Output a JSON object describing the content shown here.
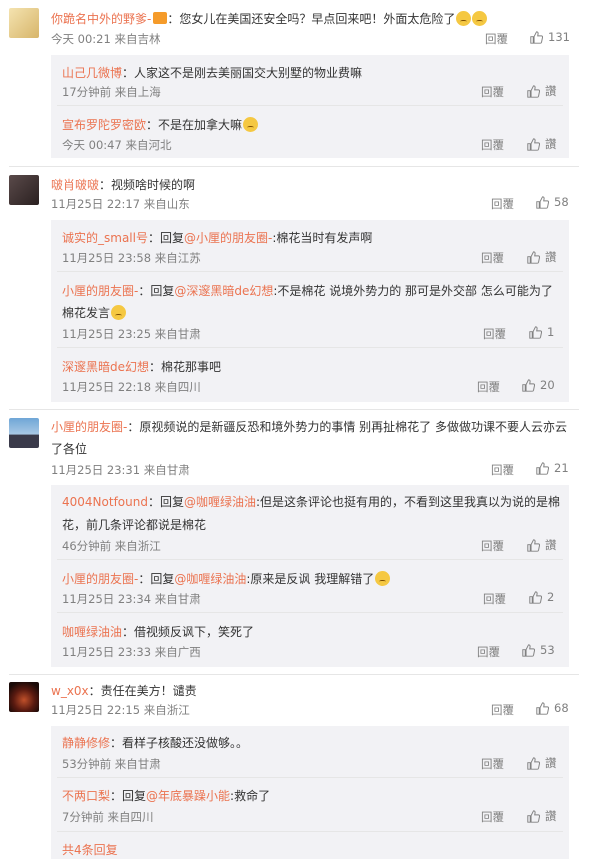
{
  "common": {
    "reply": "回覆",
    "like": "讚"
  },
  "c1": {
    "user": "你跪名中外的野爹-",
    "text": "：您女儿在美国还安全吗？早点回来吧！外面太危险了",
    "time": "今天 00:21 来自吉林",
    "likes": "131",
    "replies": [
      {
        "user": "山己几微博",
        "text": "：人家这不是刚去美丽国交大别墅的物业费嘛",
        "time": "17分钟前 来自上海"
      },
      {
        "user": "宣布罗陀罗密欧",
        "text": "：不是在加拿大嘛",
        "time": "今天 00:47 来自河北"
      }
    ]
  },
  "c2": {
    "user": "啵肖啵啵",
    "text": "：视频啥时候的啊",
    "time": "11月25日 22:17 来自山东",
    "likes": "58",
    "replies": [
      {
        "user": "诚实的_small号",
        "pre": "：回复",
        "mention": "@小厘的朋友圈-",
        "text": ":棉花当时有发声啊",
        "time": "11月25日 23:58 来自江苏"
      },
      {
        "user": "小厘的朋友圈-",
        "pre": "：回复",
        "mention": "@深邃黑暗de幻想",
        "text": ":不是棉花 说境外势力的 那可是外交部 怎么可能为了",
        "text2": "棉花发言",
        "time": "11月25日 23:25 来自甘肃",
        "likes": "1"
      },
      {
        "user": "深邃黑暗de幻想",
        "text": "：棉花那事吧",
        "time": "11月25日 22:18 来自四川",
        "likes": "20"
      }
    ]
  },
  "c3": {
    "user": "小厘的朋友圈-",
    "text": "：原视频说的是新疆反恐和境外势力的事情 别再扯棉花了 多做做功课不要人云亦云",
    "text2": "了各位",
    "time": "11月25日 23:31 来自甘肃",
    "likes": "21",
    "replies": [
      {
        "user": "4004Notfound",
        "pre": "：回复",
        "mention": "@咖喱绿油油",
        "text": ":但是这条评论也挺有用的，不看到这里我真以为说的是棉",
        "text2": "花，前几条评论都说是棉花",
        "time": "46分钟前 来自浙江"
      },
      {
        "user": "小厘的朋友圈-",
        "pre": "：回复",
        "mention": "@咖喱绿油油",
        "text": ":原来是反讽 我理解错了",
        "time": "11月25日 23:34 来自甘肃",
        "likes": "2"
      },
      {
        "user": "咖喱绿油油",
        "text": "：借视频反讽下，笑死了",
        "time": "11月25日 23:33 来自广西",
        "likes": "53"
      }
    ]
  },
  "c4": {
    "user": "w_x0x",
    "text": "：责任在美方！谴责",
    "time": "11月25日 22:15 来自浙江",
    "likes": "68",
    "replies": [
      {
        "user": "静静修修",
        "text": "：看样子核酸还没做够。。",
        "time": "53分钟前 来自甘肃"
      },
      {
        "user": "不两口梨",
        "pre": "：回复",
        "mention": "@年底暴躁小能",
        "text": ":救命了",
        "time": "7分钟前 来自四川"
      }
    ],
    "more": "共4条回复"
  }
}
